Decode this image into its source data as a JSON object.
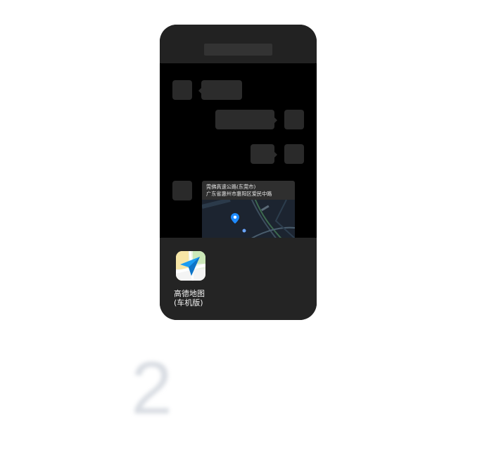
{
  "chat": {
    "location_card": {
      "title": "莞佛高速公路(东莞市)",
      "address": "广东省惠州市惠阳区爱民中路"
    }
  },
  "share_sheet": {
    "apps": [
      {
        "name_line1": "高德地图",
        "name_line2": "(车机版)",
        "icon": "amap-navigation-arrow-icon"
      }
    ]
  },
  "step": {
    "number": "2"
  },
  "colors": {
    "phone_bg": "#000000",
    "panel_bg": "#222222",
    "placeholder": "#2a2a2a",
    "map_pin": "#1e8bff",
    "icon_arrow": "#1a9cf2"
  }
}
